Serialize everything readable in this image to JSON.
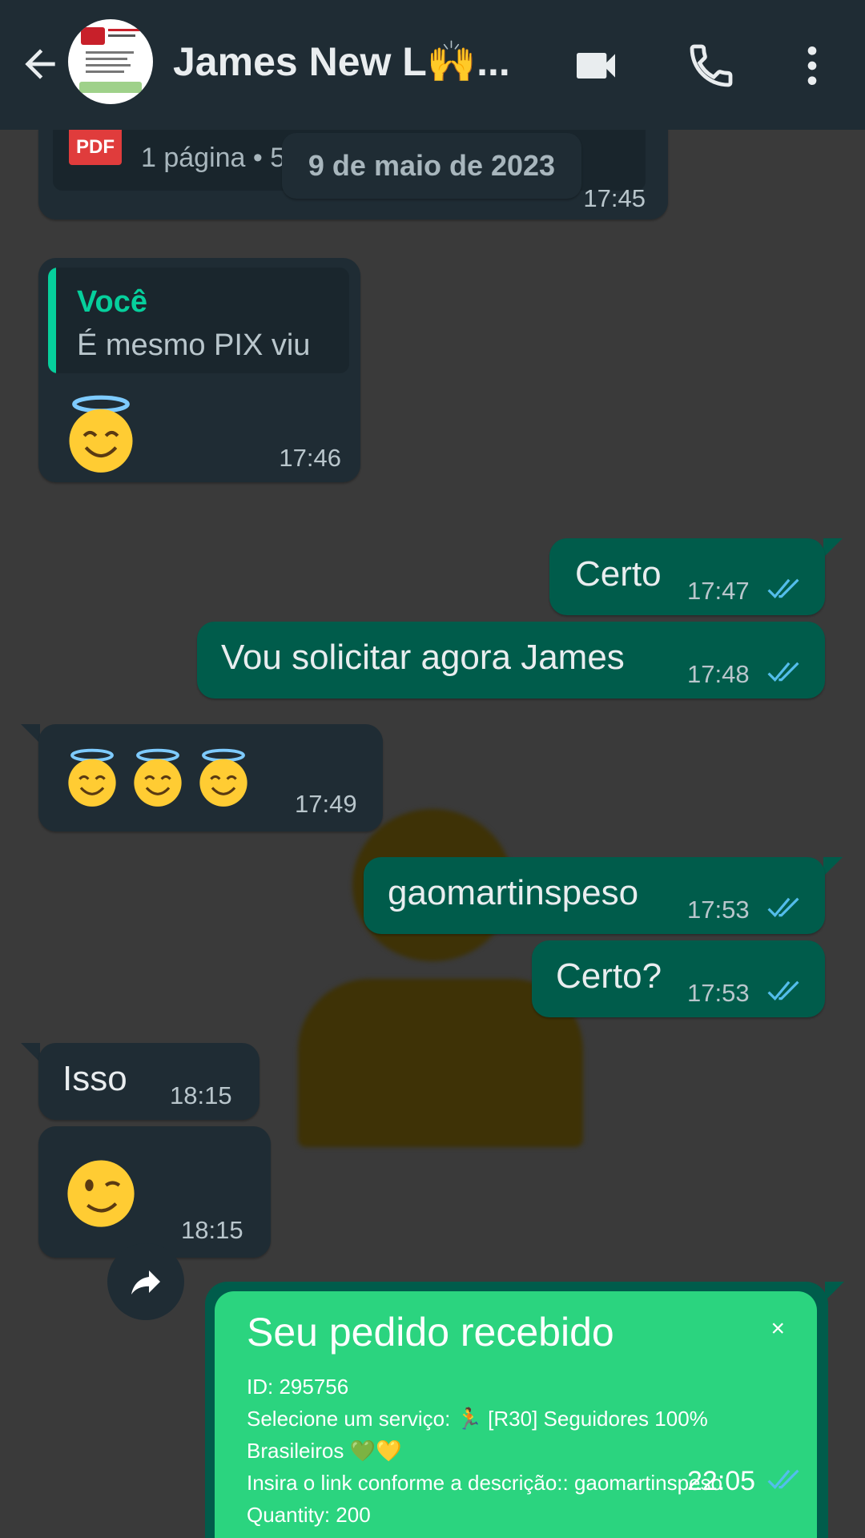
{
  "header": {
    "contact_name": "James New L🙌...",
    "back": "back-arrow-icon",
    "video": "video-call-icon",
    "call": "phone-icon",
    "menu": "more-vert-icon"
  },
  "date_chip": "9 de maio de 2023",
  "messages": {
    "doc": {
      "pages": "1 página • 5",
      "pdf_label": "PDF",
      "time": "17:45"
    },
    "reply": {
      "quoted_author": "Você",
      "quoted_text": "É mesmo PIX viu",
      "time": "17:46"
    },
    "certo": {
      "text": "Certo",
      "time": "17:47"
    },
    "vou": {
      "text": "Vou solicitar agora James",
      "time": "17:48"
    },
    "halos": {
      "time": "17:49"
    },
    "user": {
      "text": "gaomartinspeso",
      "time": "17:53"
    },
    "certo2": {
      "text": "Certo?",
      "time": "17:53"
    },
    "isso": {
      "text": "Isso",
      "time": "18:15"
    },
    "wink": {
      "time": "18:15"
    },
    "card": {
      "title": "Seu pedido recebido",
      "close": "×",
      "line1": "ID: 295756",
      "line2": "Selecione um serviço: 🏃 [R30] Seguidores 100%",
      "line3": "Brasileiros 💚💛",
      "line4": "Insira o link conforme a descrição:: gaomartinspeso",
      "line5": "Quantity: 200",
      "time": "22:05"
    }
  },
  "colors": {
    "header": "#1f2c34",
    "incoming": "#1f2c34",
    "outgoing": "#005c4b",
    "accent": "#06cf9c",
    "tick": "#53bdeb"
  }
}
